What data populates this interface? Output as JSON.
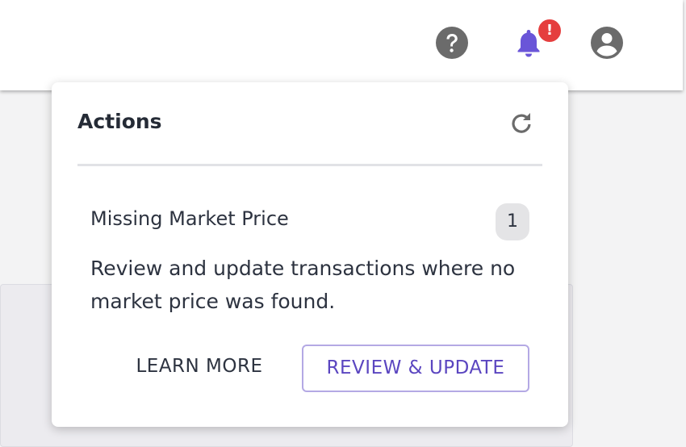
{
  "header": {
    "icons": {
      "help": "help-circle-icon",
      "notifications": "bell-icon",
      "account": "account-circle-icon"
    },
    "alert_badge": "!",
    "colors": {
      "bell": "#6a55d8",
      "alert": "#e53e3e",
      "icon_gray": "#6b6b6b"
    }
  },
  "actions_panel": {
    "title": "Actions",
    "refresh_icon": "refresh-icon",
    "items": [
      {
        "title": "Missing Market Price",
        "count": "1",
        "description": "Review and update transactions where no market price was found.",
        "learn_more_label": "LEARN MORE",
        "primary_label": "REVIEW & UPDATE"
      }
    ],
    "colors": {
      "primary_text": "#5b46c0",
      "primary_border": "#b4a9e4"
    }
  }
}
